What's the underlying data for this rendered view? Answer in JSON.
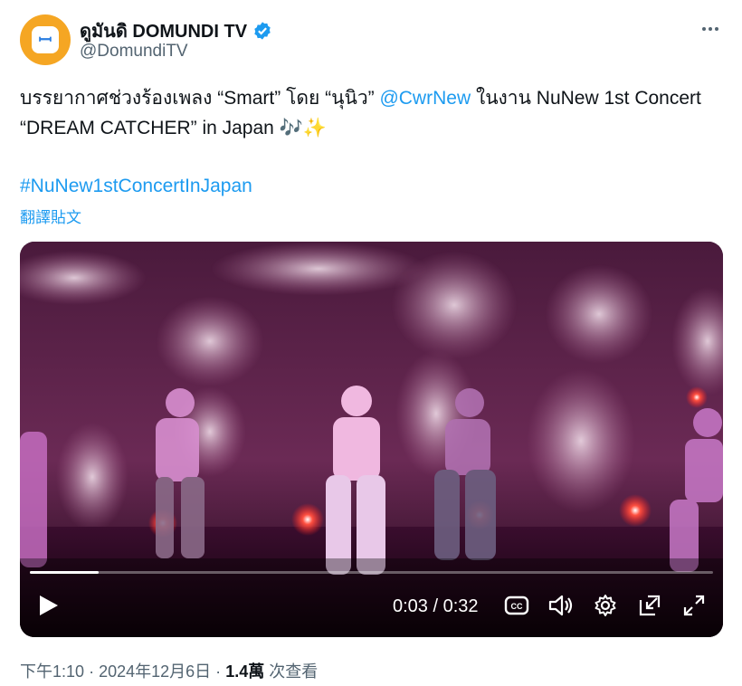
{
  "author": {
    "display_name": "ดูมันดิ DOMUNDI TV",
    "handle": "@DomundiTV",
    "verified": true,
    "avatar_color": "#f5a623"
  },
  "tweet": {
    "text_before": "บรรยากาศช่วงร้องเพลง “Smart” โดย “นุนิว” ",
    "mention": "@CwrNew",
    "text_after": " ในงาน NuNew 1st Concert “DREAM CATCHER” in Japan",
    "emoji": "🎶✨",
    "hashtag": "#NuNew1stConcertInJapan",
    "translate_label": "翻譯貼文"
  },
  "video": {
    "current_time": "0:03",
    "duration": "0:32",
    "time_display": "0:03 / 0:32",
    "progress_fraction": 0.1,
    "cc_label": "CC"
  },
  "meta": {
    "time": "下午1:10",
    "date": "2024年12月6日",
    "views_count": "1.4萬",
    "views_label": "次查看",
    "separator": "·"
  },
  "colors": {
    "link": "#1d9bf0",
    "verified": "#1d9bf0",
    "secondary_text": "#536471"
  }
}
